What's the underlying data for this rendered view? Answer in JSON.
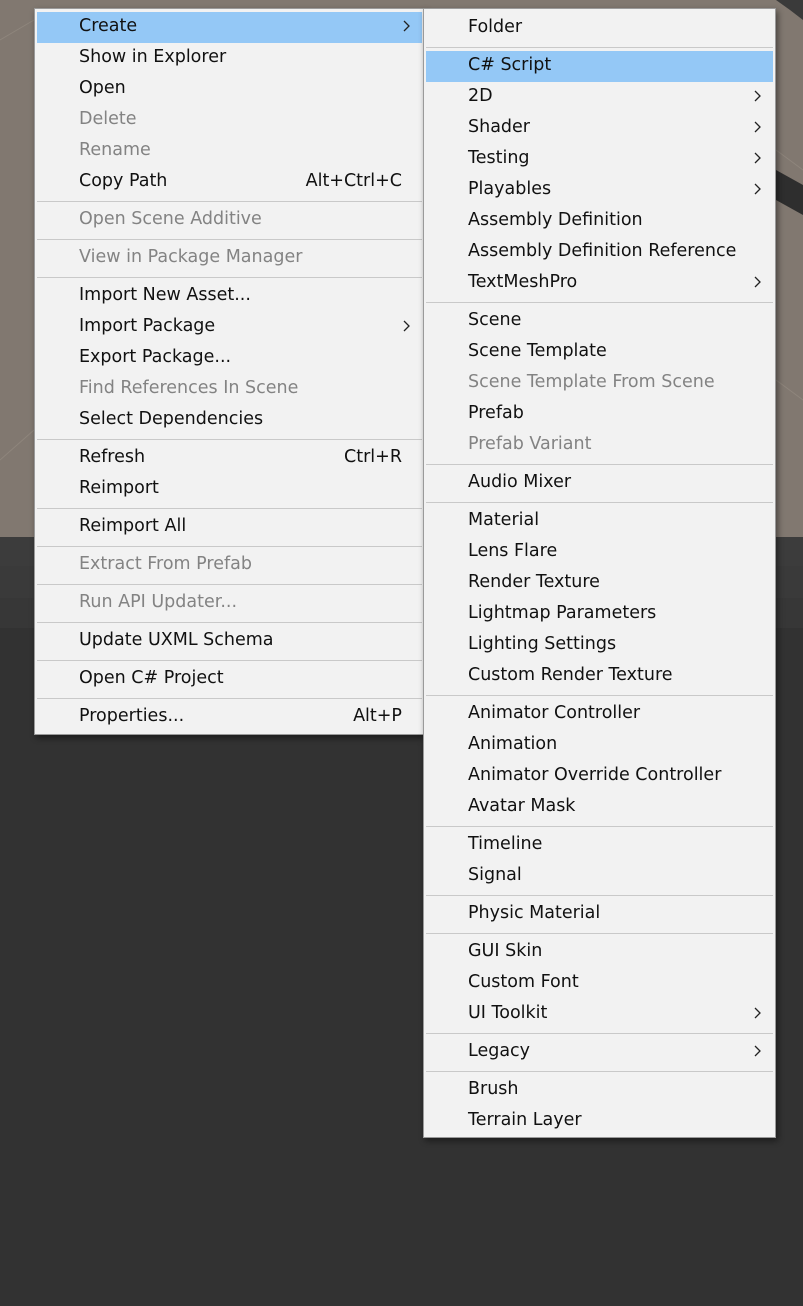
{
  "left_menu": {
    "items": [
      {
        "label": "Create",
        "shortcut": "",
        "submenu": true,
        "disabled": false,
        "highlighted": true
      },
      {
        "label": "Show in Explorer",
        "shortcut": "",
        "submenu": false,
        "disabled": false
      },
      {
        "label": "Open",
        "shortcut": "",
        "submenu": false,
        "disabled": false
      },
      {
        "label": "Delete",
        "shortcut": "",
        "submenu": false,
        "disabled": true
      },
      {
        "label": "Rename",
        "shortcut": "",
        "submenu": false,
        "disabled": true
      },
      {
        "label": "Copy Path",
        "shortcut": "Alt+Ctrl+C",
        "submenu": false,
        "disabled": false
      },
      {
        "separator": true
      },
      {
        "label": "Open Scene Additive",
        "shortcut": "",
        "submenu": false,
        "disabled": true
      },
      {
        "separator": true
      },
      {
        "label": "View in Package Manager",
        "shortcut": "",
        "submenu": false,
        "disabled": true
      },
      {
        "separator": true
      },
      {
        "label": "Import New Asset...",
        "shortcut": "",
        "submenu": false,
        "disabled": false
      },
      {
        "label": "Import Package",
        "shortcut": "",
        "submenu": true,
        "disabled": false
      },
      {
        "label": "Export Package...",
        "shortcut": "",
        "submenu": false,
        "disabled": false
      },
      {
        "label": "Find References In Scene",
        "shortcut": "",
        "submenu": false,
        "disabled": true
      },
      {
        "label": "Select Dependencies",
        "shortcut": "",
        "submenu": false,
        "disabled": false
      },
      {
        "separator": true
      },
      {
        "label": "Refresh",
        "shortcut": "Ctrl+R",
        "submenu": false,
        "disabled": false
      },
      {
        "label": "Reimport",
        "shortcut": "",
        "submenu": false,
        "disabled": false
      },
      {
        "separator": true
      },
      {
        "label": "Reimport All",
        "shortcut": "",
        "submenu": false,
        "disabled": false
      },
      {
        "separator": true
      },
      {
        "label": "Extract From Prefab",
        "shortcut": "",
        "submenu": false,
        "disabled": true
      },
      {
        "separator": true
      },
      {
        "label": "Run API Updater...",
        "shortcut": "",
        "submenu": false,
        "disabled": true
      },
      {
        "separator": true
      },
      {
        "label": "Update UXML Schema",
        "shortcut": "",
        "submenu": false,
        "disabled": false
      },
      {
        "separator": true
      },
      {
        "label": "Open C# Project",
        "shortcut": "",
        "submenu": false,
        "disabled": false
      },
      {
        "separator": true
      },
      {
        "label": "Properties...",
        "shortcut": "Alt+P",
        "submenu": false,
        "disabled": false
      }
    ]
  },
  "right_menu": {
    "items": [
      {
        "label": "Folder",
        "submenu": false,
        "disabled": false
      },
      {
        "separator": true
      },
      {
        "label": "C# Script",
        "submenu": false,
        "disabled": false,
        "highlighted": true
      },
      {
        "label": "2D",
        "submenu": true,
        "disabled": false
      },
      {
        "label": "Shader",
        "submenu": true,
        "disabled": false
      },
      {
        "label": "Testing",
        "submenu": true,
        "disabled": false
      },
      {
        "label": "Playables",
        "submenu": true,
        "disabled": false
      },
      {
        "label": "Assembly Definition",
        "submenu": false,
        "disabled": false
      },
      {
        "label": "Assembly Definition Reference",
        "submenu": false,
        "disabled": false
      },
      {
        "label": "TextMeshPro",
        "submenu": true,
        "disabled": false
      },
      {
        "separator": true
      },
      {
        "label": "Scene",
        "submenu": false,
        "disabled": false
      },
      {
        "label": "Scene Template",
        "submenu": false,
        "disabled": false
      },
      {
        "label": "Scene Template From Scene",
        "submenu": false,
        "disabled": true
      },
      {
        "label": "Prefab",
        "submenu": false,
        "disabled": false
      },
      {
        "label": "Prefab Variant",
        "submenu": false,
        "disabled": true
      },
      {
        "separator": true
      },
      {
        "label": "Audio Mixer",
        "submenu": false,
        "disabled": false
      },
      {
        "separator": true
      },
      {
        "label": "Material",
        "submenu": false,
        "disabled": false
      },
      {
        "label": "Lens Flare",
        "submenu": false,
        "disabled": false
      },
      {
        "label": "Render Texture",
        "submenu": false,
        "disabled": false
      },
      {
        "label": "Lightmap Parameters",
        "submenu": false,
        "disabled": false
      },
      {
        "label": "Lighting Settings",
        "submenu": false,
        "disabled": false
      },
      {
        "label": "Custom Render Texture",
        "submenu": false,
        "disabled": false
      },
      {
        "separator": true
      },
      {
        "label": "Animator Controller",
        "submenu": false,
        "disabled": false
      },
      {
        "label": "Animation",
        "submenu": false,
        "disabled": false
      },
      {
        "label": "Animator Override Controller",
        "submenu": false,
        "disabled": false
      },
      {
        "label": "Avatar Mask",
        "submenu": false,
        "disabled": false
      },
      {
        "separator": true
      },
      {
        "label": "Timeline",
        "submenu": false,
        "disabled": false
      },
      {
        "label": "Signal",
        "submenu": false,
        "disabled": false
      },
      {
        "separator": true
      },
      {
        "label": "Physic Material",
        "submenu": false,
        "disabled": false
      },
      {
        "separator": true
      },
      {
        "label": "GUI Skin",
        "submenu": false,
        "disabled": false
      },
      {
        "label": "Custom Font",
        "submenu": false,
        "disabled": false
      },
      {
        "label": "UI Toolkit",
        "submenu": true,
        "disabled": false
      },
      {
        "separator": true
      },
      {
        "label": "Legacy",
        "submenu": true,
        "disabled": false
      },
      {
        "separator": true
      },
      {
        "label": "Brush",
        "submenu": false,
        "disabled": false
      },
      {
        "label": "Terrain Layer",
        "submenu": false,
        "disabled": false
      }
    ]
  },
  "icons": {
    "submenu_arrow": "chevron-right-icon"
  },
  "colors": {
    "menu_bg": "#f2f2f2",
    "highlight": "#94c8f6",
    "disabled_text": "#838383",
    "editor_bg": "#323232"
  }
}
